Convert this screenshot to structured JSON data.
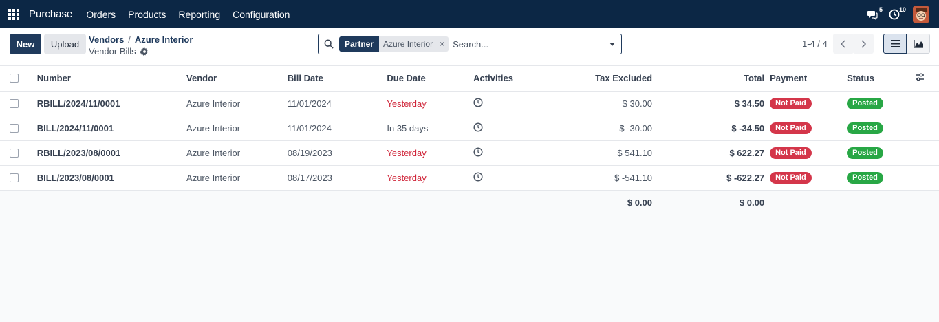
{
  "navbar": {
    "app_name": "Purchase",
    "menu": [
      "Orders",
      "Products",
      "Reporting",
      "Configuration"
    ],
    "messages_count": "5",
    "activities_count": "10",
    "bg_color": "#0c2745"
  },
  "control": {
    "new_label": "New",
    "upload_label": "Upload",
    "breadcrumb": [
      "Vendors",
      "Azure Interior"
    ],
    "breadcrumb_sep": "/",
    "subtitle": "Vendor Bills",
    "search": {
      "facet_name": "Partner",
      "facet_value": "Azure Interior",
      "facet_remove": "×",
      "placeholder": "Search..."
    },
    "pager": "1-4 / 4"
  },
  "table": {
    "headers": {
      "number": "Number",
      "vendor": "Vendor",
      "bill_date": "Bill Date",
      "due_date": "Due Date",
      "activities": "Activities",
      "tax_excluded": "Tax Excluded",
      "total": "Total",
      "payment": "Payment",
      "status": "Status"
    },
    "rows": [
      {
        "number": "RBILL/2024/11/0001",
        "vendor": "Azure Interior",
        "bill_date": "11/01/2024",
        "due_date": "Yesterday",
        "due_overdue": true,
        "tax_excluded": "$ 30.00",
        "total": "$ 34.50",
        "payment": "Not Paid",
        "status": "Posted"
      },
      {
        "number": "BILL/2024/11/0001",
        "vendor": "Azure Interior",
        "bill_date": "11/01/2024",
        "due_date": "In 35 days",
        "due_overdue": false,
        "tax_excluded": "$ -30.00",
        "total": "$ -34.50",
        "payment": "Not Paid",
        "status": "Posted"
      },
      {
        "number": "RBILL/2023/08/0001",
        "vendor": "Azure Interior",
        "bill_date": "08/19/2023",
        "due_date": "Yesterday",
        "due_overdue": true,
        "tax_excluded": "$ 541.10",
        "total": "$ 622.27",
        "payment": "Not Paid",
        "status": "Posted"
      },
      {
        "number": "BILL/2023/08/0001",
        "vendor": "Azure Interior",
        "bill_date": "08/17/2023",
        "due_date": "Yesterday",
        "due_overdue": true,
        "tax_excluded": "$ -541.10",
        "total": "$ -622.27",
        "payment": "Not Paid",
        "status": "Posted"
      }
    ],
    "footer": {
      "tax_excluded_sum": "$ 0.00",
      "total_sum": "$ 0.00"
    }
  }
}
